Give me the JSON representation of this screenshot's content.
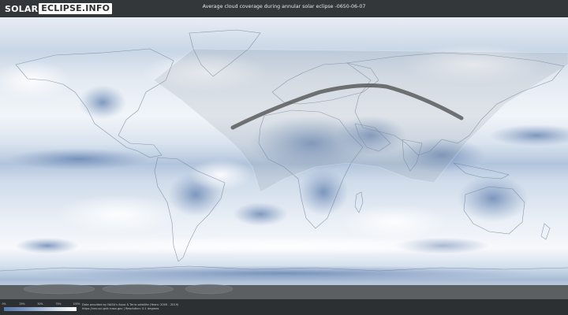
{
  "logo": {
    "part1": "SOLAR",
    "part2": "ECLIPSE.INFO"
  },
  "header": {
    "title": "Average cloud coverage during annular solar eclipse -0650-06-07"
  },
  "legend": {
    "ticks": [
      "0%",
      "25%",
      "50%",
      "75%",
      "100%"
    ],
    "colors": [
      "#5a79a9",
      "#7893bd",
      "#a4b8d3",
      "#d5e0ec",
      "#ffffff"
    ]
  },
  "credits": {
    "line1": "Data provided by NASA's Aqua & Terra satellite (Years: 2000 - 2019)",
    "line2": "https://neo.sci.gsfc.nasa.gov | Resolution: 0.1 degrees"
  },
  "colors": {
    "background": "#2d3033",
    "ocean_cloud_low": "#6f8cb7",
    "cloud_high": "#f2f5f9",
    "eclipse_path": "#4a4a4a"
  }
}
